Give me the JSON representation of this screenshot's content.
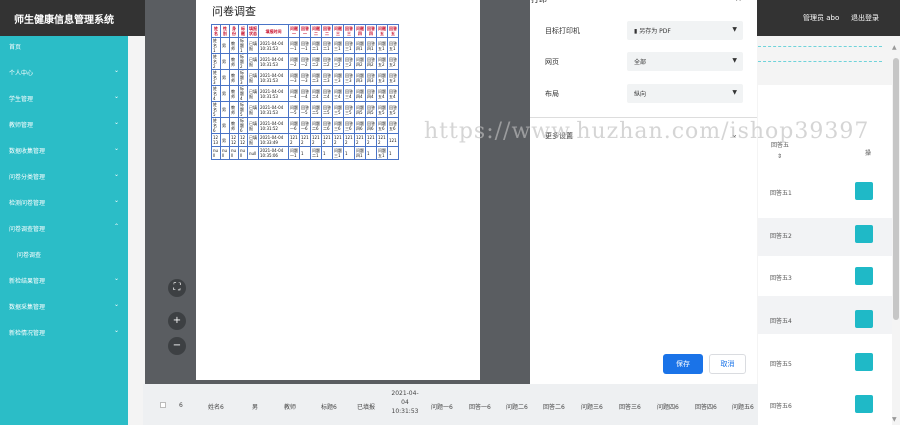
{
  "header": {
    "title": "师生健康信息管理系统",
    "admin": "管理员 abo",
    "logout": "退出登录"
  },
  "sidebar": {
    "items": [
      {
        "label": "首页",
        "chevron": false
      },
      {
        "label": "个人中心",
        "chevron": true
      },
      {
        "label": "学生管理",
        "chevron": true
      },
      {
        "label": "教师管理",
        "chevron": true
      },
      {
        "label": "数据收集管理",
        "chevron": true
      },
      {
        "label": "问卷分类管理",
        "chevron": true
      },
      {
        "label": "检测问卷管理",
        "chevron": true
      },
      {
        "label": "问卷调查管理",
        "chevron": true,
        "expanded": true
      },
      {
        "label": "问卷调查",
        "chevron": false,
        "sub": true
      },
      {
        "label": "新检结果管理",
        "chevron": true
      },
      {
        "label": "数据采集管理",
        "chevron": true
      },
      {
        "label": "新检情况管理",
        "chevron": true
      }
    ]
  },
  "table": {
    "col_header": "回答五",
    "col_header_sort": "⇕",
    "col_op": "操",
    "rows": [
      "回答五1",
      "回答五2",
      "回答五3",
      "回答五4",
      "回答五5",
      "回答五6"
    ]
  },
  "bottom_row": [
    "6",
    "姓名6",
    "男",
    "教师",
    "标题6",
    "已填报",
    "2021-04-04 10:31:53",
    "问题一6",
    "回答一6",
    "问题二6",
    "回答二6",
    "问题三6",
    "回答三6",
    "问题四6",
    "回答四6",
    "问题五6",
    "回答五6"
  ],
  "print_preview": {
    "title": "问卷调查",
    "headers": [
      "姓名",
      "性别",
      "身份",
      "标题",
      "填报状态",
      "填报时间",
      "问题一",
      "回答一",
      "问题二",
      "回答二",
      "问题三",
      "回答三",
      "问题四",
      "回答四",
      "问题五",
      "回答五"
    ],
    "rows": [
      [
        "姓名1",
        "男",
        "教师",
        "标题1",
        "已填报",
        "2021-04-04 10:31:53",
        "问题一1",
        "回答一1",
        "问题二1",
        "回答二1",
        "问题三1",
        "回答三1",
        "问题四1",
        "回答四1",
        "问题五1",
        "回答五1"
      ],
      [
        "姓名2",
        "男",
        "教师",
        "标题2",
        "已填报",
        "2021-04-04 10:31:53",
        "问题一2",
        "回答一2",
        "问题二2",
        "回答二2",
        "问题三2",
        "回答三2",
        "问题四2",
        "回答四2",
        "问题五2",
        "回答五2"
      ],
      [
        "姓名3",
        "男",
        "教师",
        "标题3",
        "已填报",
        "2021-04-04 10:31:53",
        "问题一3",
        "回答一3",
        "问题二3",
        "回答二3",
        "问题三3",
        "回答三3",
        "问题四3",
        "回答四3",
        "问题五3",
        "回答五3"
      ],
      [
        "姓名4",
        "男",
        "教师",
        "标题4",
        "已填报",
        "2021-04-04 10:31:53",
        "问题一4",
        "回答一4",
        "问题二4",
        "回答二4",
        "问题三4",
        "回答三4",
        "问题四4",
        "回答四4",
        "问题五4",
        "回答五4"
      ],
      [
        "姓名5",
        "男",
        "教师",
        "标题5",
        "已填报",
        "2021-04-04 10:31:53",
        "问题一5",
        "回答一5",
        "问题二5",
        "回答二5",
        "问题三5",
        "回答三5",
        "问题四5",
        "回答四5",
        "问题五5",
        "回答五5"
      ],
      [
        "姓名6",
        "男",
        "教师",
        "标题6",
        "已填报",
        "2021-04-04 10:31:52",
        "问题一6",
        "回答一6",
        "问题二6",
        "回答二6",
        "问题三6",
        "回答三6",
        "问题四6",
        "回答四6",
        "问题五6",
        "回答五6"
      ],
      [
        "1213",
        "男",
        "1212",
        "1212",
        "已填报",
        "2021-04-04 10:33:49",
        "1212",
        "1212",
        "1212",
        "1212",
        "1212",
        "1212",
        "1212",
        "1212",
        "1212",
        "121"
      ],
      [
        "null",
        "null",
        "null",
        "null",
        "null",
        "2021-04-04 10:35:06",
        "问题一1",
        "1",
        "问题二1",
        "1",
        "问题三1",
        "1",
        "问题四1",
        "1",
        "问题五1",
        "1"
      ]
    ]
  },
  "print_settings": {
    "heading": "打印",
    "close": "×",
    "printer_label": "目标打印机",
    "printer_value": "另存为 PDF",
    "pages_label": "网页",
    "pages_value": "全部",
    "layout_label": "布局",
    "layout_value": "纵向",
    "more": "更多设置",
    "save": "保存",
    "cancel": "取消"
  },
  "watermark": "https://www.huzhan.com/ishop39397",
  "colors": {
    "sidebar": "#2bbdc7",
    "header": "#333333",
    "primary_button": "#1a73e8",
    "op_button": "#1fb9c7",
    "preview_header_text": "#c8102e"
  }
}
